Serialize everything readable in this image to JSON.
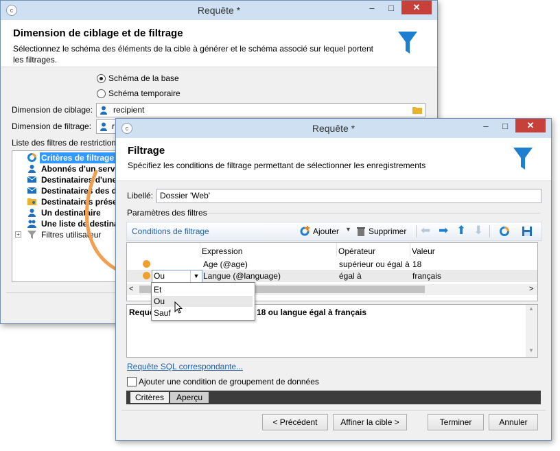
{
  "back_window": {
    "title": "Requête *",
    "header_title": "Dimension de ciblage et de filtrage",
    "header_desc": "Sélectionnez le schéma des éléments de la cible à générer et le schéma associé sur lequel portent les filtrages.",
    "radio_base": "Schéma de la base",
    "radio_temp": "Schéma temporaire",
    "targeting_label": "Dimension de ciblage:",
    "targeting_value": "recipient",
    "filtering_label": "Dimension de filtrage:",
    "filtering_value": "r",
    "filter_list_label": "Liste des filtres de restrictions",
    "tree": [
      "Critères de filtrage",
      "Abonnés d'un service",
      "Destinataires d'une",
      "Destinataires des di",
      "Destinataires présen",
      "Un destinataire",
      "Une liste de destina",
      "Filtres utilisateur"
    ]
  },
  "front_window": {
    "title": "Requête *",
    "header_title": "Filtrage",
    "header_desc": "Spécifiez les conditions de filtrage permettant de sélectionner les enregistrements",
    "libelle_label": "Libellé:",
    "libelle_value": "Dossier 'Web'",
    "params_label": "Paramètres des filtres",
    "conditions_label": "Conditions de filtrage",
    "add_label": "Ajouter",
    "delete_label": "Supprimer",
    "columns": [
      "Expression",
      "Opérateur",
      "Valeur"
    ],
    "rows": [
      {
        "expression": "Age (@age)",
        "operator": "supérieur ou égal à",
        "value": "18"
      },
      {
        "expression": "Langue (@language)",
        "operator": "égal à",
        "value": "français"
      }
    ],
    "combo_value": "Ou",
    "dropdown_options": [
      "Et",
      "Ou",
      "Sauf"
    ],
    "summary_left": "Requê",
    "summary_right": "18 ou langue égal à français",
    "sql_link": "Requête SQL correspondante...",
    "group_checkbox": "Ajouter une condition de groupement de données",
    "tab_criteria": "Critères",
    "tab_preview": "Aperçu",
    "btn_prev": "< Précédent",
    "btn_target": "Affiner la cible >",
    "btn_finish": "Terminer",
    "btn_cancel": "Annuler"
  },
  "colors": {
    "accent": "#1e7fd0",
    "titlebar": "#cfe0f3",
    "close": "#c7413a",
    "selection": "#3399ff",
    "arrow": "#f0a050"
  }
}
